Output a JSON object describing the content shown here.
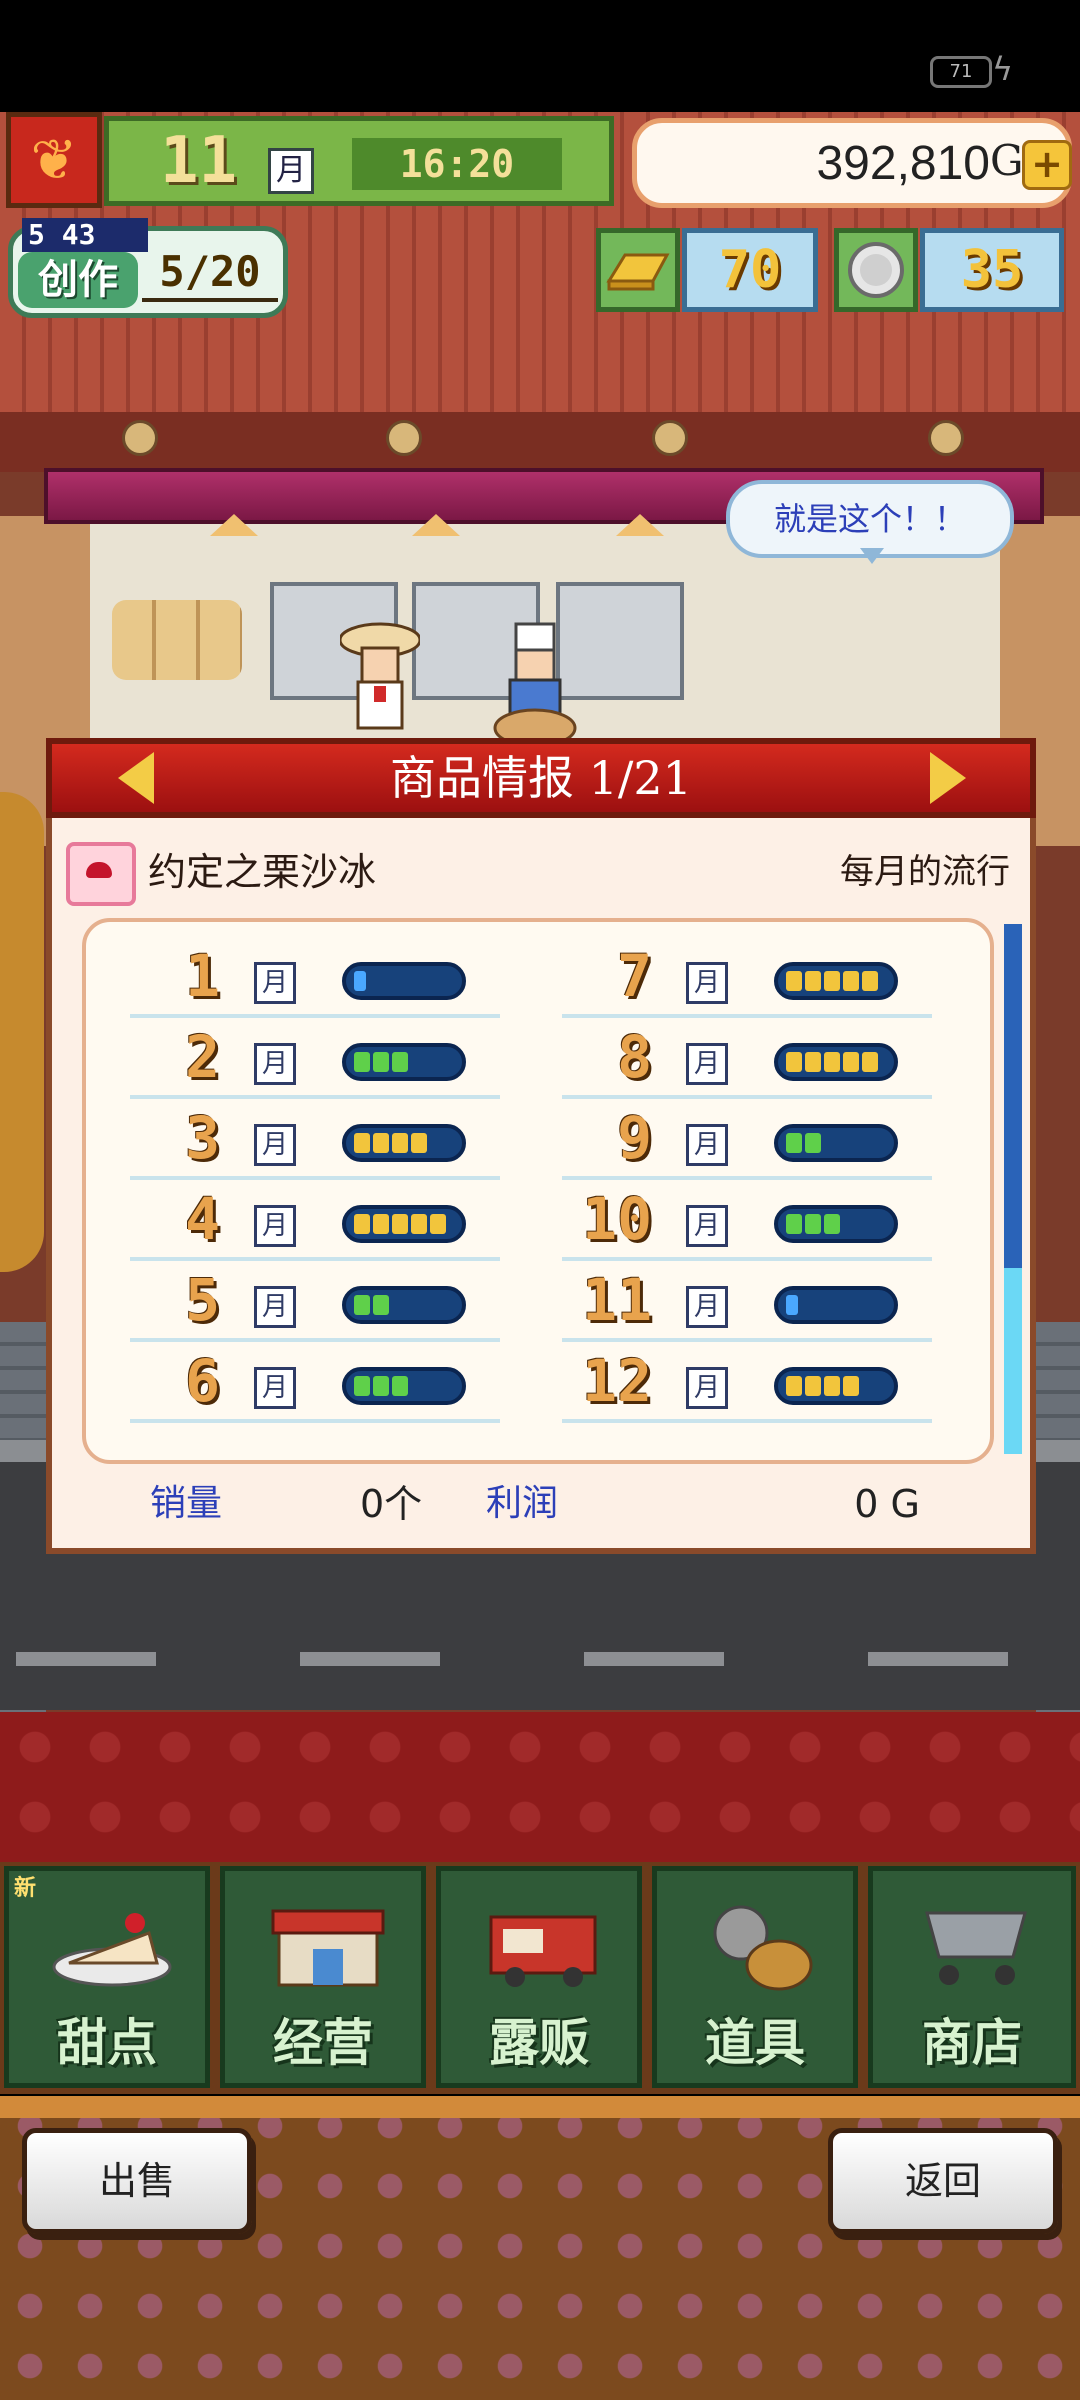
{
  "status_bar": {
    "battery": "71"
  },
  "hud": {
    "month_num": "11",
    "month_unit": "月",
    "time": "16:20",
    "money": "392,810",
    "money_unit": "G",
    "plus": "+",
    "craft_level": "5 43",
    "craft_label": "创作",
    "craft_count": "5/20",
    "gold_bars": "70",
    "silver_coins": "35"
  },
  "scene": {
    "speech_bubble": "就是这个！！"
  },
  "panel": {
    "title": "商品情报 1/21",
    "item_name": "约定之栗沙冰",
    "trend_label": "每月的流行",
    "month_unit": "月",
    "months_left": [
      {
        "month": "1",
        "level": 0
      },
      {
        "month": "2",
        "level": 3
      },
      {
        "month": "3",
        "level": 4
      },
      {
        "month": "4",
        "level": 5
      },
      {
        "month": "5",
        "level": 2
      },
      {
        "month": "6",
        "level": 3
      }
    ],
    "months_right": [
      {
        "month": "7",
        "level": 5
      },
      {
        "month": "8",
        "level": 5
      },
      {
        "month": "9",
        "level": 2
      },
      {
        "month": "10",
        "level": 3
      },
      {
        "month": "11",
        "level": 0
      },
      {
        "month": "12",
        "level": 4
      }
    ],
    "sales_label": "销量",
    "sales_value": "0个",
    "profit_label": "利润",
    "profit_value": "0 G"
  },
  "menu": {
    "new_badge": "新",
    "items": [
      {
        "label": "甜点",
        "icon": "cake-icon"
      },
      {
        "label": "经营",
        "icon": "shop-building-icon"
      },
      {
        "label": "露贩",
        "icon": "food-truck-icon"
      },
      {
        "label": "道具",
        "icon": "gear-bag-icon"
      },
      {
        "label": "商店",
        "icon": "shopping-cart-icon"
      }
    ]
  },
  "buttons": {
    "sell": "出售",
    "back": "返回"
  },
  "colors": {
    "bar_empty": "#17427b",
    "bar_green": "#5fd04a",
    "bar_yellow": "#f2c53c",
    "bar_blue": "#4aa8ff",
    "title_red": "#c41c14"
  }
}
